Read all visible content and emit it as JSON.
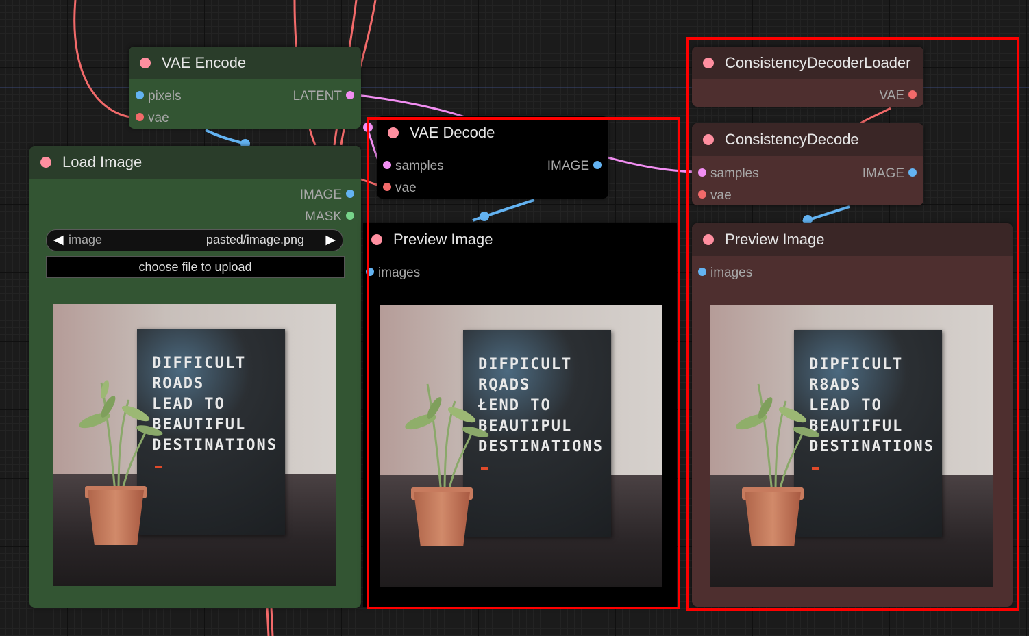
{
  "nodes": {
    "vae_encode": {
      "title": "VAE Encode",
      "inputs": [
        "pixels",
        "vae"
      ],
      "outputs": [
        "LATENT"
      ]
    },
    "load_image": {
      "title": "Load Image",
      "outputs": [
        "IMAGE",
        "MASK"
      ],
      "combo_label": "image",
      "combo_value": "pasted/image.png",
      "upload_label": "choose file to upload"
    },
    "vae_decode": {
      "title": "VAE Decode",
      "inputs": [
        "samples",
        "vae"
      ],
      "outputs": [
        "IMAGE"
      ]
    },
    "preview_image_1": {
      "title": "Preview Image",
      "inputs": [
        "images"
      ]
    },
    "consistency_decoder_loader": {
      "title": "ConsistencyDecoderLoader",
      "outputs": [
        "VAE"
      ]
    },
    "consistency_decode": {
      "title": "ConsistencyDecode",
      "inputs": [
        "samples",
        "vae"
      ],
      "outputs": [
        "IMAGE"
      ]
    },
    "preview_image_2": {
      "title": "Preview Image",
      "inputs": [
        "images"
      ]
    }
  },
  "image_text": {
    "original": "DIFFICULT\nROADS\nLEAD TO\nBEAUTIFUL\nDESTINATIONS",
    "vae_decoded": "DIFPICULT\nRQADS\nŁEND TO\nBEAUTIPUL\nDESTINATIONS",
    "consistency_decoded": "DIPFICULT\nR8ADS\nLEAD TO\nBEAUTIFUL\nDESTINATIONS"
  },
  "colors": {
    "canvas_bg": "#1b1b1b",
    "green_node_header": "#2a3d2a",
    "green_node_body": "#335533",
    "black_node": "#000000",
    "brown_node_header": "#3a2626",
    "brown_node_body": "#4e2f2f",
    "selection": "#ff0000",
    "link_vae": "#f26a6a",
    "link_image": "#63b3f2",
    "link_latent": "#f28ef2"
  }
}
